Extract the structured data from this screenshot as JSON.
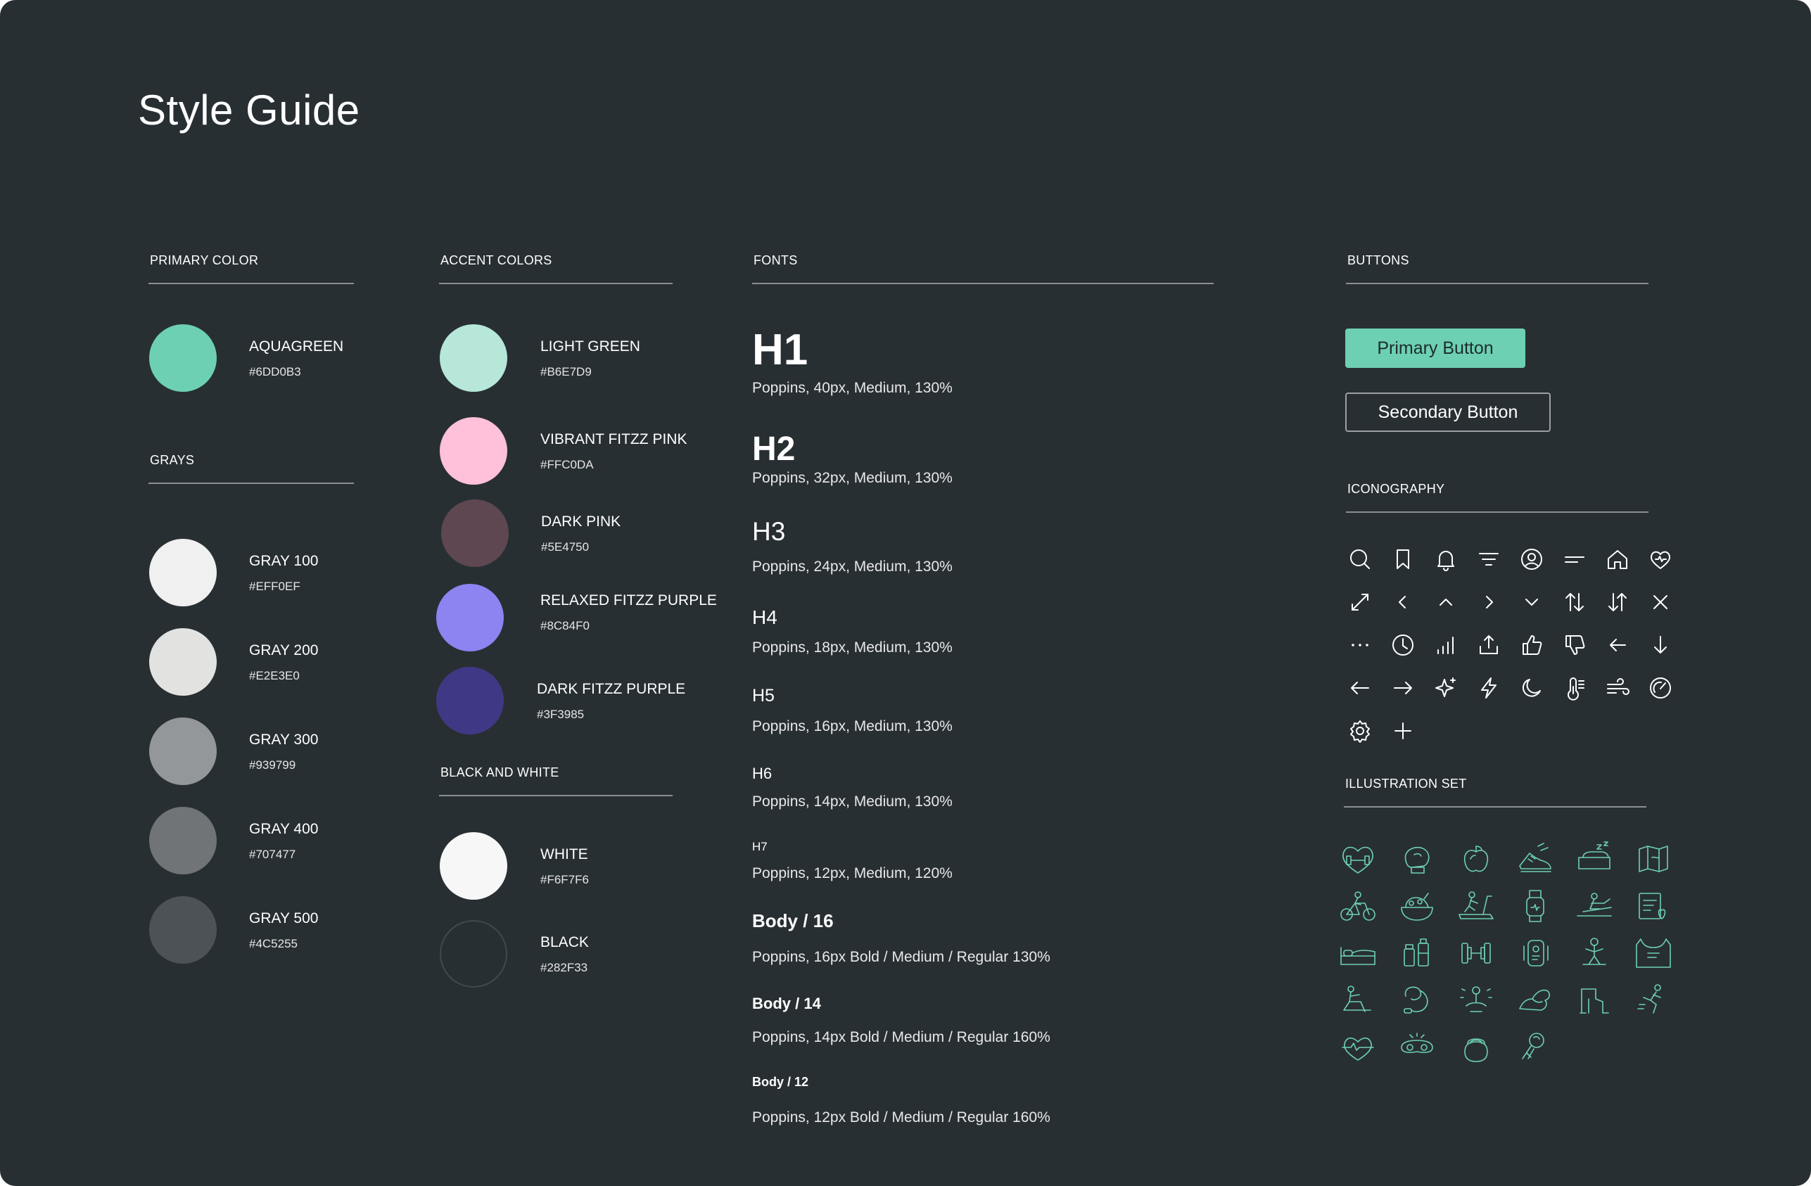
{
  "page_title": "Style Guide",
  "primary": {
    "label": "PRIMARY COLOR",
    "swatch": {
      "name": "AQUAGREEN",
      "hex": "#6DD0B3",
      "hex_label": "#6DD0B3"
    }
  },
  "grays": {
    "label": "GRAYS",
    "items": [
      {
        "name": "GRAY 100",
        "hex": "#EFF0EF",
        "hex_label": "#EFF0EF"
      },
      {
        "name": "GRAY 200",
        "hex": "#E2E3E0",
        "hex_label": "#E2E3E0"
      },
      {
        "name": "GRAY 300",
        "hex": "#939799",
        "hex_label": "#939799"
      },
      {
        "name": "GRAY 400",
        "hex": "#707477",
        "hex_label": "#707477"
      },
      {
        "name": "GRAY 500",
        "hex": "#4C5255",
        "hex_label": "#4C5255"
      }
    ]
  },
  "accent": {
    "label": "ACCENT COLORS",
    "items": [
      {
        "name": "LIGHT GREEN",
        "hex": "#B6E7D9",
        "hex_label": "#B6E7D9"
      },
      {
        "name": "VIBRANT FITZZ PINK",
        "hex": "#FFC0DA",
        "hex_label": "#FFC0DA"
      },
      {
        "name": "DARK PINK",
        "hex": "#5E4750",
        "hex_label": "#5E4750"
      },
      {
        "name": "RELAXED FITZZ PURPLE",
        "hex": "#8C84F0",
        "hex_label": "#8C84F0"
      },
      {
        "name": "DARK FITZZ PURPLE",
        "hex": "#3F3985",
        "hex_label": "#3F3985"
      }
    ]
  },
  "bw": {
    "label": "BLACK AND WHITE",
    "items": [
      {
        "name": "WHITE",
        "hex": "#F6F7F6",
        "hex_label": "#F6F7F6"
      },
      {
        "name": "BLACK",
        "hex": "#282F33",
        "hex_label": "#282F33"
      }
    ]
  },
  "fonts": {
    "label": "FONTS",
    "items": [
      {
        "head": "H1",
        "desc": "Poppins, 40px, Medium, 130%"
      },
      {
        "head": "H2",
        "desc": "Poppins, 32px, Medium, 130%"
      },
      {
        "head": "H3",
        "desc": "Poppins, 24px, Medium, 130%"
      },
      {
        "head": "H4",
        "desc": "Poppins, 18px, Medium, 130%"
      },
      {
        "head": "H5",
        "desc": "Poppins, 16px, Medium, 130%"
      },
      {
        "head": "H6",
        "desc": "Poppins, 14px, Medium, 130%"
      },
      {
        "head": "H7",
        "desc": "Poppins, 12px, Medium, 120%"
      },
      {
        "head": "Body / 16",
        "desc": "Poppins, 16px Bold / Medium / Regular 130%"
      },
      {
        "head": "Body / 14",
        "desc": "Poppins, 14px Bold / Medium / Regular 160%"
      },
      {
        "head": "Body / 12",
        "desc": "Poppins, 12px Bold / Medium / Regular 160%"
      }
    ]
  },
  "buttons": {
    "label": "BUTTONS",
    "primary_label": "Primary Button",
    "secondary_label": "Secondary Button",
    "primary_color": "#6DD0B3"
  },
  "iconography": {
    "label": "ICONOGRAPHY",
    "icons": [
      "search-icon",
      "bookmark-icon",
      "bell-icon",
      "filter-icon",
      "user-circle-icon",
      "menu-lines-icon",
      "home-icon",
      "heart-pulse-icon",
      "resize-diagonal-icon",
      "chevron-left-icon",
      "chevron-up-icon",
      "chevron-right-icon",
      "chevron-down-icon",
      "sort-arrows-icon",
      "sort-arrows-alt-icon",
      "close-icon",
      "more-dots-icon",
      "clock-icon",
      "signal-bars-icon",
      "upload-icon",
      "thumbs-up-icon",
      "thumbs-down-icon",
      "arrow-left-icon",
      "arrow-down-icon",
      "arrow-left-long-icon",
      "arrow-right-icon",
      "sparkle-icon",
      "lightning-icon",
      "moon-icon",
      "thermometer-icon",
      "wind-icon",
      "speedometer-icon",
      "settings-icon",
      "plus-icon"
    ]
  },
  "illustrations": {
    "label": "ILLUSTRATION SET",
    "color": "#6DD0B3",
    "items": [
      "heart-dumbbell-illustration",
      "boxing-glove-illustration",
      "apple-illustration",
      "running-shoe-illustration",
      "sleep-illustration",
      "map-illustration",
      "cycling-illustration",
      "healthy-food-illustration",
      "treadmill-illustration",
      "smartwatch-illustration",
      "rowing-illustration",
      "recipe-illustration",
      "bed-illustration",
      "supplements-illustration",
      "dumbbell-illustration",
      "fitness-tracker-illustration",
      "yoga-illustration",
      "tank-top-illustration",
      "stretching-illustration",
      "jump-rope-illustration",
      "meditation-illustration",
      "flexed-arm-illustration",
      "leg-stretch-illustration",
      "running-person-illustration",
      "heartbeat-illustration",
      "sleep-mask-illustration",
      "kettlebell-illustration",
      "massage-illustration"
    ]
  }
}
